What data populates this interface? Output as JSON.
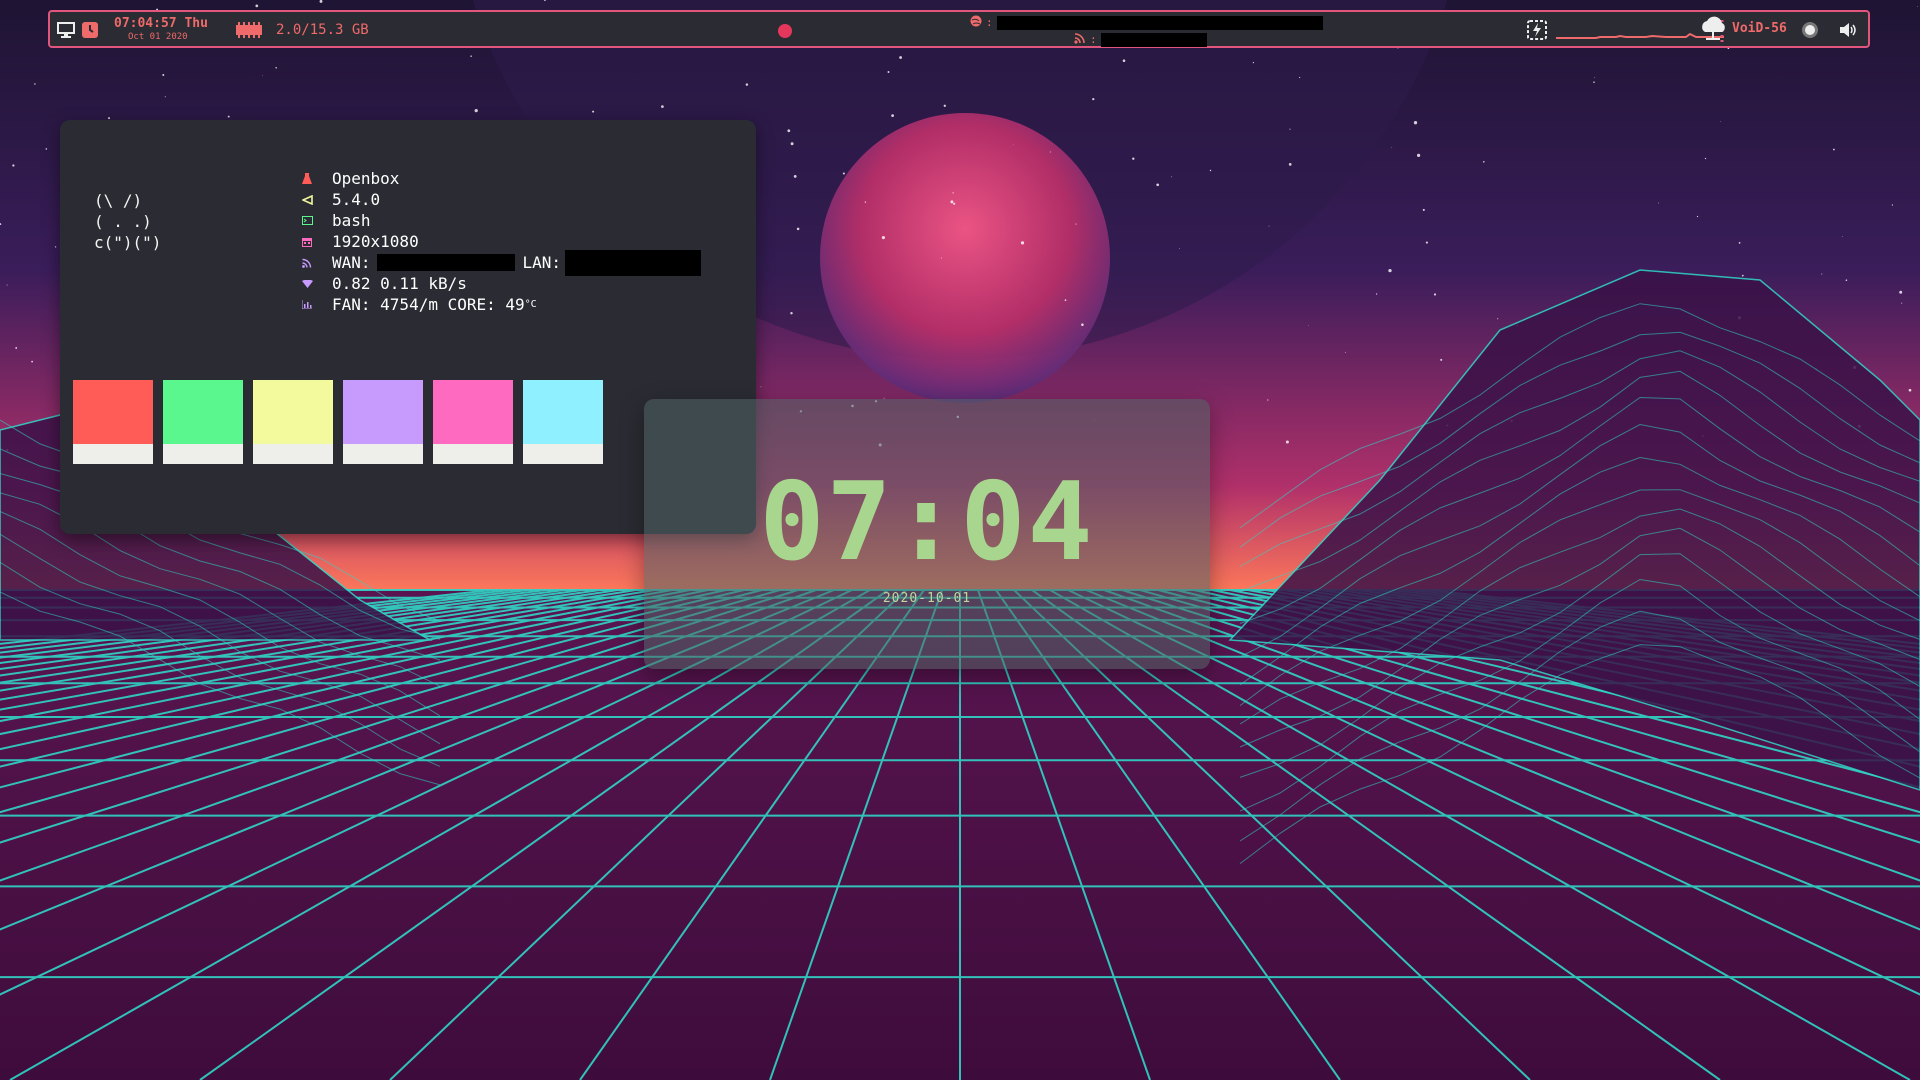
{
  "topbar": {
    "clock_time": "07:04:57 Thu",
    "clock_date": "Oct 01 2020",
    "memory": "2.0/15.3 GB",
    "net_row1_label": ":",
    "net_row2_label": ":",
    "hostname": "VoiD-56",
    "icons": [
      "desktop-icon",
      "clock-icon",
      "memory-chip-icon",
      "record-dot-icon",
      "globe-icon",
      "rss-icon",
      "battery-bolt-icon",
      "network-graph",
      "cloud-icon",
      "brightness-icon",
      "volume-icon"
    ]
  },
  "neofetch": {
    "ascii": "(\\ /)\n( . .)\nc(\")(\")",
    "rows": {
      "wm": "Openbox",
      "kernel": "5.4.0",
      "shell": "bash",
      "resolution": "1920x1080",
      "wan_label": "WAN:",
      "lan_label": "LAN:",
      "net_speed": "0.82  0.11 kB/s",
      "fan_core": "FAN: 4754/m CORE: 49",
      "temp_unit": "°C"
    },
    "swatch_colors": [
      "#ff5c57",
      "#5af78e",
      "#f3f99d",
      "#c79bfe",
      "#ff6ac1",
      "#8ff0ff"
    ]
  },
  "clock_widget": {
    "time": "07:04",
    "date": "2020-10-01"
  },
  "colors": {
    "accent": "#e2557c",
    "bar_text": "#ef6a6a",
    "clock_green": "#a9d68f",
    "grid_cyan": "#2fd6c6"
  }
}
